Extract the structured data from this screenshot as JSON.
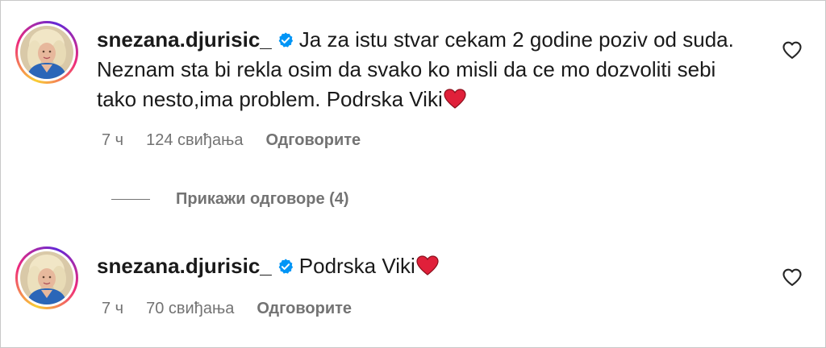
{
  "comments": [
    {
      "username": "snezana.djurisic_",
      "verified": true,
      "text": "Ja za istu stvar cekam 2 godine poziv od suda. Neznam sta bi rekla osim da svako ko misli da ce mo dozvoliti sebi tako nesto,ima problem. Podrska Viki",
      "time": "7 ч",
      "likes": "124 свиђања",
      "reply_label": "Одговорите"
    },
    {
      "username": "snezana.djurisic_",
      "verified": true,
      "text": "Podrska Viki",
      "time": "7 ч",
      "likes": "70 свиђања",
      "reply_label": "Одговорите"
    }
  ],
  "view_replies_label": "Прикажи одговоре (4)",
  "icons": {
    "verified": "verified-badge-icon",
    "heart_emoji": "red-heart-emoji",
    "like": "heart-outline-icon"
  },
  "colors": {
    "text": "#1a1a1a",
    "muted": "#737373",
    "verified": "#0095f6",
    "heart": "#e0203a"
  }
}
